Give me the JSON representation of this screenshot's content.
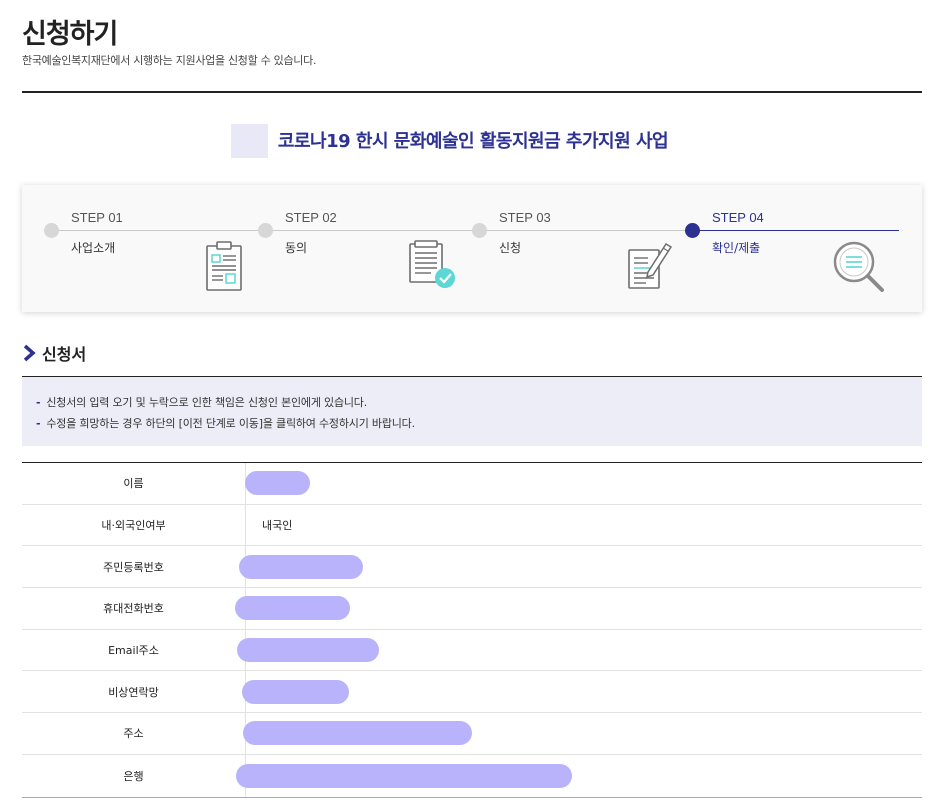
{
  "header": {
    "title": "신청하기",
    "subtitle": "한국예술인복지재단에서 시행하는 지원사업을 신청할 수 있습니다."
  },
  "program": {
    "title": "코로나19 한시 문화예술인 활동지원금 추가지원 사업"
  },
  "steps": [
    {
      "number": "STEP 01",
      "label": "사업소개",
      "icon": "clipboard-icon",
      "active": false
    },
    {
      "number": "STEP 02",
      "label": "동의",
      "icon": "document-check-icon",
      "active": false
    },
    {
      "number": "STEP 03",
      "label": "신청",
      "icon": "document-pen-icon",
      "active": false
    },
    {
      "number": "STEP 04",
      "label": "확인/제출",
      "icon": "magnifier-icon",
      "active": true
    }
  ],
  "section": {
    "title": "신청서",
    "icon": "chevron-right-icon"
  },
  "notices": [
    "신청서의 입력 오기 및 누락으로 인한 책임은 신청인 본인에게 있습니다.",
    "수정을 희망하는 경우 하단의 [이전 단계로 이동]을 클릭하여 수정하시기 바랍니다."
  ],
  "table": {
    "rows": [
      {
        "label": "이름",
        "value": ""
      },
      {
        "label": "내·외국인여부",
        "value": "내국인"
      },
      {
        "label": "주민등록번호",
        "value": ""
      },
      {
        "label": "휴대전화번호",
        "value": ""
      },
      {
        "label": "Email주소",
        "value": ""
      },
      {
        "label": "비상연락망",
        "value": ""
      },
      {
        "label": "주소",
        "value": ""
      },
      {
        "label": "은행",
        "value": ""
      }
    ]
  },
  "colors": {
    "accent": "#2c3192",
    "redaction": "#b9b3fb",
    "icon_teal": "#5dd6d6",
    "notice_bg": "#ededf7"
  }
}
